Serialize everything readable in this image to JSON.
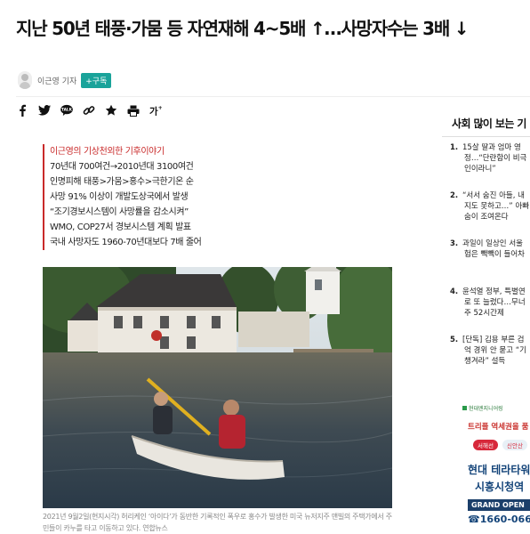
{
  "headline": "지난 50년 태풍·가뭄 등 자연재해 4~5배 ↑…사망자수는 3배 ↓",
  "byline": {
    "reporter": "이근영 기자",
    "subscribe_label": "+구독"
  },
  "share_icons": [
    "facebook-icon",
    "twitter-icon",
    "kakaotalk-icon",
    "link-icon",
    "star-icon",
    "print-icon",
    "font-size-icon"
  ],
  "summary": {
    "series": "이근영의 기상천외한 기후이야기",
    "lines": [
      "70년대 700여건→2010년대 3100여건",
      "인명피해 태풍>가뭄>홍수>극한기온 순",
      "사망 91% 이상이 개발도상국에서 발생",
      "“조기경보시스템이 사망률을 감소시켜”",
      "WMO, COP27서 경보시스템 계획 발표",
      "국내 사망자도 1960-70년대보다 7배 줄어"
    ]
  },
  "photo": {
    "caption_line1": "2021년 9월2일(현지시각) 허리케인 ‘아이다’가 동반한 기록적인 폭우로 홍수가 발생한 미국 뉴저지주 맨빌의 주택가에서 주",
    "caption_line2": "민들이 카누를 타고 이동하고 있다. 연합뉴스"
  },
  "sidebar": {
    "title": "사회 많이 보는 기",
    "items": [
      {
        "num": "1.",
        "lines": [
          "15살 딸과 엄마 영",
          "정…“단란함이 비극",
          "인이라니”"
        ]
      },
      {
        "num": "2.",
        "lines": [
          "“서서 숨진 아들, 내",
          "지도 못하고…” 아빠",
          "숨이 조여온다"
        ]
      },
      {
        "num": "3.",
        "lines": [
          "과일이 일상인 서울",
          "험은 빽빽이 들어차"
        ]
      },
      {
        "num": "4.",
        "lines": [
          "윤석열 정부, 특별연",
          "로 또 늘렸다…무너",
          "주 52시간제"
        ]
      },
      {
        "num": "5.",
        "lines": [
          "[단독] 김용 부른 검",
          "억 경위 안 묻고 “기",
          "챙겨라” 설득"
        ]
      }
    ]
  },
  "ad": {
    "brand": "현대엔지니어링",
    "promo": "트리플 역세권을 품",
    "tag1": "서해선",
    "tag2": "신안산",
    "title1": "현대 테라타워",
    "title2": "시흥시청역",
    "open_label": "GRAND OPEN",
    "phone": "1660-0660"
  }
}
